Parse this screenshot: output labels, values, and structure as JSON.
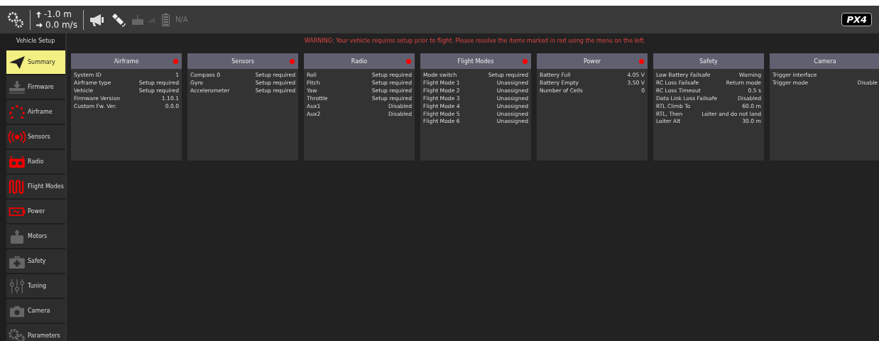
{
  "toolbar": {
    "altitude": "-1.0 m",
    "speed": "0.0 m/s",
    "battery": "N/A",
    "logo": "PX4"
  },
  "sidebar": {
    "title": "Vehicle Setup",
    "items": [
      {
        "label": "Summary",
        "kind": "plane",
        "selected": true
      },
      {
        "label": "Firmware",
        "kind": "download",
        "selected": false,
        "needs_setup": false
      },
      {
        "label": "Airframe",
        "kind": "dots",
        "selected": false,
        "needs_setup": true
      },
      {
        "label": "Sensors",
        "kind": "signal",
        "selected": false,
        "needs_setup": true
      },
      {
        "label": "Radio",
        "kind": "radio",
        "selected": false,
        "needs_setup": true
      },
      {
        "label": "Flight Modes",
        "kind": "wave",
        "selected": false,
        "needs_setup": true
      },
      {
        "label": "Power",
        "kind": "battery",
        "selected": false,
        "needs_setup": true
      },
      {
        "label": "Motors",
        "kind": "motor",
        "selected": false,
        "needs_setup": false
      },
      {
        "label": "Safety",
        "kind": "kit",
        "selected": false,
        "needs_setup": false
      },
      {
        "label": "Tuning",
        "kind": "sliders",
        "selected": false,
        "needs_setup": false
      },
      {
        "label": "Camera",
        "kind": "camera",
        "selected": false,
        "needs_setup": false
      },
      {
        "label": "Parameters",
        "kind": "gears",
        "selected": false,
        "needs_setup": false
      }
    ]
  },
  "warning": "WARNING: Your vehicle requires setup prior to flight. Please resolve the items marked in red using the menu on the left.",
  "cards": [
    {
      "title": "Airframe",
      "needs_setup": true,
      "rows": [
        [
          "System ID",
          "1"
        ],
        [
          "Airframe type",
          "Setup required"
        ],
        [
          "Vehicle",
          "Setup required"
        ],
        [
          "Firmware Version",
          "1.10.1"
        ],
        [
          "Custom Fw. Ver.",
          "0.0.0"
        ]
      ]
    },
    {
      "title": "Sensors",
      "needs_setup": true,
      "rows": [
        [
          "Compass 0",
          "Setup required"
        ],
        [
          "Gyro",
          "Setup required"
        ],
        [
          "Accelerometer",
          "Setup required"
        ]
      ]
    },
    {
      "title": "Radio",
      "needs_setup": true,
      "rows": [
        [
          "Roll",
          "Setup required"
        ],
        [
          "Pitch",
          "Setup required"
        ],
        [
          "Yaw",
          "Setup required"
        ],
        [
          "Throttle",
          "Setup required"
        ],
        [
          "Aux1",
          "Disabled"
        ],
        [
          "Aux2",
          "Disabled"
        ]
      ]
    },
    {
      "title": "Flight Modes",
      "needs_setup": true,
      "rows": [
        [
          "Mode switch",
          "Setup required"
        ],
        [
          "Flight Mode 1",
          "Unassigned"
        ],
        [
          "Flight Mode 2",
          "Unassigned"
        ],
        [
          "Flight Mode 3",
          "Unassigned"
        ],
        [
          "Flight Mode 4",
          "Unassigned"
        ],
        [
          "Flight Mode 5",
          "Unassigned"
        ],
        [
          "Flight Mode 6",
          "Unassigned"
        ]
      ]
    },
    {
      "title": "Power",
      "needs_setup": true,
      "rows": [
        [
          "Battery Full",
          "4.05 V"
        ],
        [
          "Battery Empty",
          "3.50 V"
        ],
        [
          "Number of Cells",
          "0"
        ]
      ]
    },
    {
      "title": "Safety",
      "needs_setup": false,
      "rows": [
        [
          "Low Battery Failsafe",
          "Warning"
        ],
        [
          "RC Loss Failsafe",
          "Return mode"
        ],
        [
          "RC Loss Timeout",
          "0.5 s"
        ],
        [
          "Data Link Loss Failsafe",
          "Disabled"
        ],
        [
          "RTL Climb To",
          "60.0 m"
        ],
        [
          "RTL, Then",
          "Loiter and do not land"
        ],
        [
          "Loiter Alt",
          "30.0 m"
        ]
      ]
    },
    {
      "title": "Camera",
      "needs_setup": false,
      "rows": [
        [
          "Trigger interface",
          ""
        ],
        [
          "Trigger mode",
          "Disable"
        ]
      ]
    }
  ]
}
